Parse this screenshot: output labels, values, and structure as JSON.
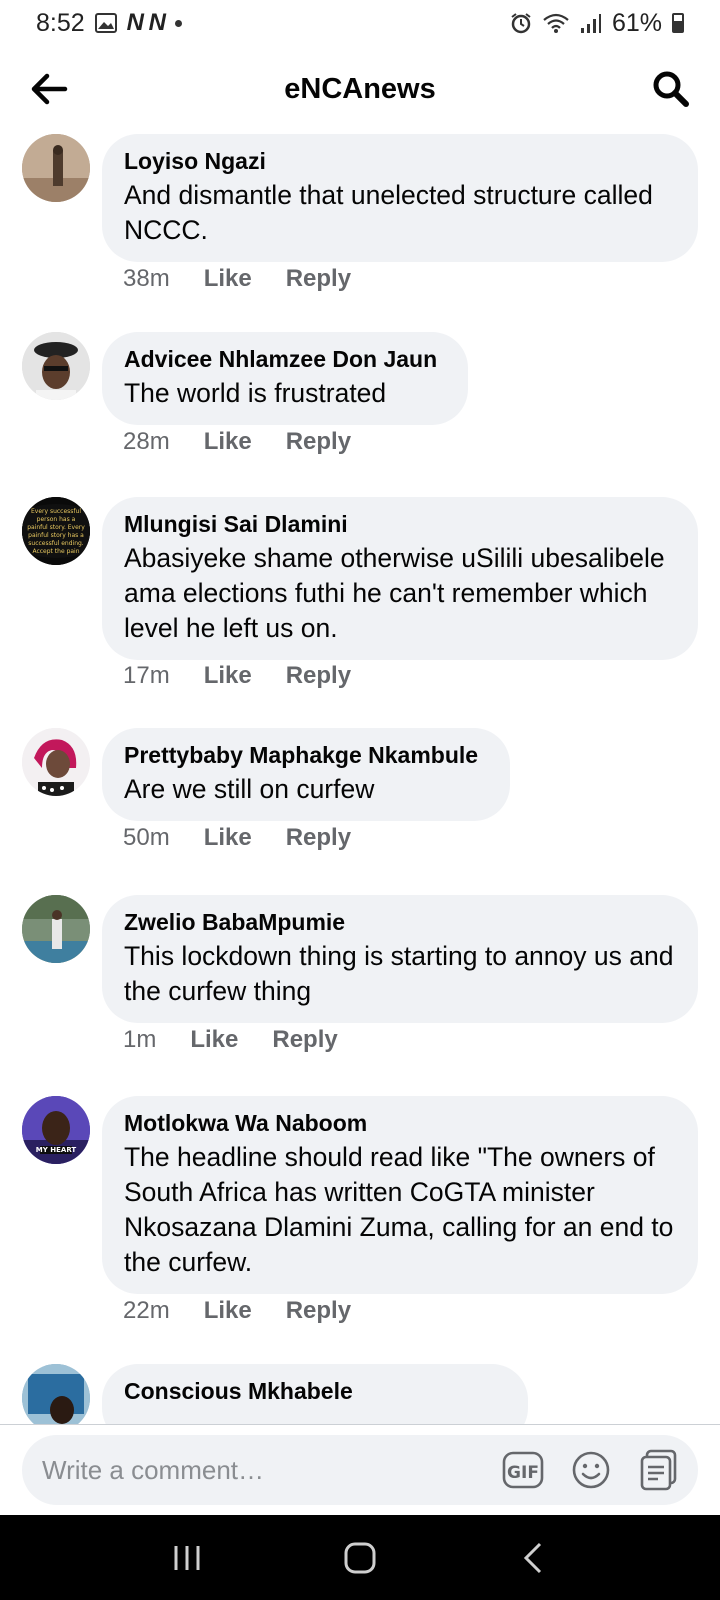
{
  "status_bar": {
    "time": "8:52",
    "notif_letters": "N N",
    "battery": "61%"
  },
  "header": {
    "title": "eNCAnews",
    "back_icon": "arrow-left-icon",
    "search_icon": "search-icon"
  },
  "comments": [
    {
      "author": "Loyiso Ngazi",
      "text": "And dismantle that unelected structure called NCCC.",
      "time": "38m",
      "like": "Like",
      "reply": "Reply"
    },
    {
      "author": "Advicee Nhlamzee Don Jaun",
      "text": "The world is frustrated",
      "time": "28m",
      "like": "Like",
      "reply": "Reply"
    },
    {
      "author": "Mlungisi Sai Dlamini",
      "text": "Abasiyeke shame otherwise uSilili ubesalibele ama elections futhi he can't remember which level he left us on.",
      "time": "17m",
      "like": "Like",
      "reply": "Reply"
    },
    {
      "author": "Prettybaby Maphakge Nkambule",
      "text": "Are we still on curfew",
      "time": "50m",
      "like": "Like",
      "reply": "Reply"
    },
    {
      "author": "Zwelio BabaMpumie",
      "text": "This lockdown thing is starting to annoy us and the curfew thing",
      "time": "1m",
      "like": "Like",
      "reply": "Reply"
    },
    {
      "author": "Motlokwa Wa Naboom",
      "text": "The headline should read like \"The owners of South Africa has written CoGTA minister Nkosazana Dlamini Zuma, calling for an end to the curfew.",
      "time": "22m",
      "like": "Like",
      "reply": "Reply"
    },
    {
      "author": "Conscious Mkhabele"
    }
  ],
  "avatar_texts": {
    "mlungisi": "Every successful person has a painful story. Every painful story has a successful ending. Accept the pain and get ready..."
  },
  "composer": {
    "placeholder": "Write a comment…",
    "gif_label": "GIF"
  }
}
